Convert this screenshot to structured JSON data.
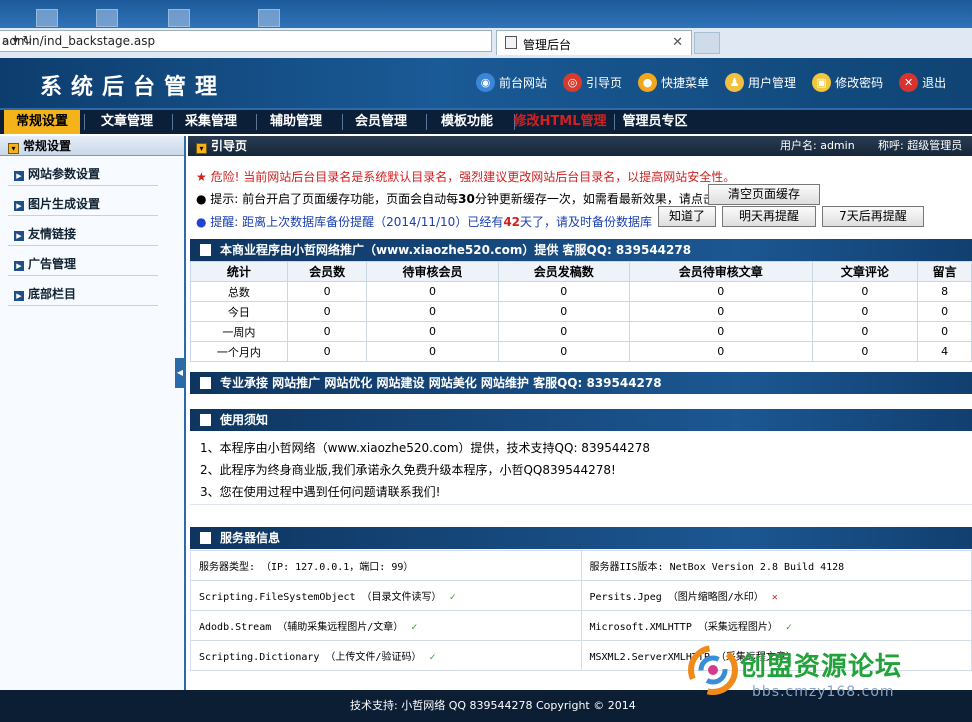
{
  "browser": {
    "address": "admin/ind_backstage.asp",
    "address_controls": "⌕ ▾ ↻",
    "tab_title": "管理后台",
    "tab_close": "✕"
  },
  "header": {
    "title": "系统后台管理",
    "nav": [
      {
        "label": "前台网站",
        "icon": "globe-icon",
        "color": "#3b86d6"
      },
      {
        "label": "引导页",
        "icon": "lifebuoy-icon",
        "color": "#d83a2e"
      },
      {
        "label": "快捷菜单",
        "icon": "orange-circle-icon",
        "color": "#f2a81c"
      },
      {
        "label": "用户管理",
        "icon": "user-icon",
        "color": "#f0c040"
      },
      {
        "label": "修改密码",
        "icon": "lock-icon",
        "color": "#f3c63d"
      },
      {
        "label": "退出",
        "icon": "close-circle-icon",
        "color": "#d8332e"
      }
    ]
  },
  "menu": {
    "items": [
      "常规设置",
      "文章管理",
      "采集管理",
      "辅助管理",
      "会员管理",
      "模板功能",
      "修改HTML管理",
      "管理员专区"
    ],
    "active_index": 0,
    "highlight_color": "#d32020"
  },
  "sidebar": {
    "title": "常规设置",
    "items": [
      "网站参数设置",
      "图片生成设置",
      "友情链接",
      "广告管理",
      "底部栏目"
    ]
  },
  "crumb": {
    "label": "引导页",
    "user": "用户名: admin",
    "greet": "称呼: 超级管理员"
  },
  "alerts": {
    "danger": "危险! 当前网站后台目录名是系统默认目录名，强烈建议更改网站后台目录名，以提高网站安全性。",
    "tip_prefix": "提示: 前台开启了页面缓存功能，页面会自动每",
    "tip_minutes": "30",
    "tip_suffix": "分钟更新缓存一次，如需看最新效果，请点击",
    "clear_cache": "清空页面缓存",
    "remind_prefix": "提醒: 距离上次数据库备份提醒（2014/11/10）已经有",
    "remind_days": "42",
    "remind_suffix": "天了，请及时备份数据库",
    "ack": "知道了",
    "tomorrow": "明天再提醒",
    "week": "7天后再提醒"
  },
  "stats": {
    "title": "本商业程序由小哲网络推广（www.xiaozhe520.com）提供 客服QQ: 839544278",
    "columns": [
      "统计",
      "会员数",
      "待审核会员",
      "会员发稿数",
      "会员待审核文章",
      "文章评论",
      "留言"
    ],
    "rows": [
      [
        "总数",
        "0",
        "0",
        "0",
        "0",
        "0",
        "8"
      ],
      [
        "今日",
        "0",
        "0",
        "0",
        "0",
        "0",
        "0"
      ],
      [
        "一周内",
        "0",
        "0",
        "0",
        "0",
        "0",
        "0"
      ],
      [
        "一个月内",
        "0",
        "0",
        "0",
        "0",
        "0",
        "4"
      ]
    ]
  },
  "promo": "专业承接 网站推广 网站优化 网站建设 网站美化 网站维护 客服QQ: 839544278",
  "notice": {
    "title": "使用须知",
    "lines": [
      "1、本程序由小哲网络（www.xiaozhe520.com）提供，技术支持QQ: 839544278",
      "2、此程序为终身商业版,我们承诺永久免费升级本程序，小哲QQ839544278!",
      "3、您在使用过程中遇到任何问题请联系我们!"
    ]
  },
  "server": {
    "title": "服务器信息",
    "rows": [
      [
        {
          "text": "服务器类型: （IP: 127.0.0.1，端口: 99）",
          "mark": ""
        },
        {
          "text": "服务器IIS版本: NetBox Version 2.8 Build 4128",
          "mark": ""
        }
      ],
      [
        {
          "text": "Scripting.FileSystemObject （目录文件读写）",
          "mark": "✓"
        },
        {
          "text": "Persits.Jpeg （图片缩略图/水印）",
          "mark": "✕"
        }
      ],
      [
        {
          "text": "Adodb.Stream （辅助采集远程图片/文章）",
          "mark": "✓"
        },
        {
          "text": "Microsoft.XMLHTTP （采集远程图片）",
          "mark": "✓"
        }
      ],
      [
        {
          "text": "Scripting.Dictionary （上传文件/验证码）",
          "mark": "✓"
        },
        {
          "text": "MSXML2.ServerXMLHTTP （采集远程文章）",
          "mark": ""
        }
      ]
    ]
  },
  "footer": "技术支持: 小哲网络 QQ 839544278 Copyright © 2014",
  "watermark": {
    "name": "创盟资源论坛",
    "url": "bbs.cmzy168.com"
  }
}
